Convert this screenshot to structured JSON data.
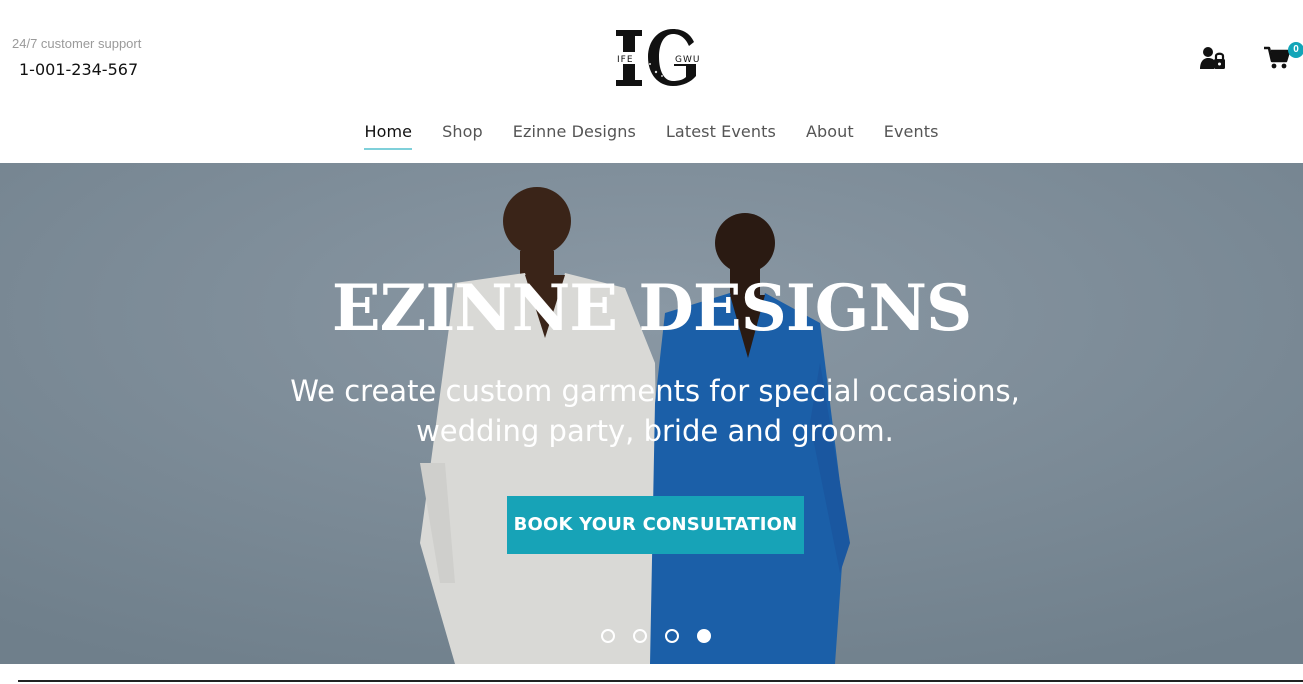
{
  "header": {
    "support_label": "24/7 customer support",
    "support_phone": "1-001-234-567",
    "logo": {
      "monogram": "IG",
      "left_text": "IFE",
      "right_text": "GWU"
    },
    "cart_count": "0",
    "icons": {
      "account": "user-lock-icon",
      "cart": "shopping-cart-icon"
    }
  },
  "nav": {
    "items": [
      {
        "label": "Home",
        "active": true
      },
      {
        "label": "Shop"
      },
      {
        "label": "Ezinne Designs"
      },
      {
        "label": "Latest Events"
      },
      {
        "label": "About"
      },
      {
        "label": "Events"
      }
    ]
  },
  "hero": {
    "title": "EZINNE DESIGNS",
    "text": "We create custom garments for special occasions, wedding party, bride and groom.",
    "cta": "BOOK YOUR CONSULTATION",
    "slide_count": 4,
    "active_slide": 4
  },
  "colors": {
    "accent": "#17a3b7",
    "badge": "#12a5b8",
    "sky": "#7f8e9a"
  }
}
